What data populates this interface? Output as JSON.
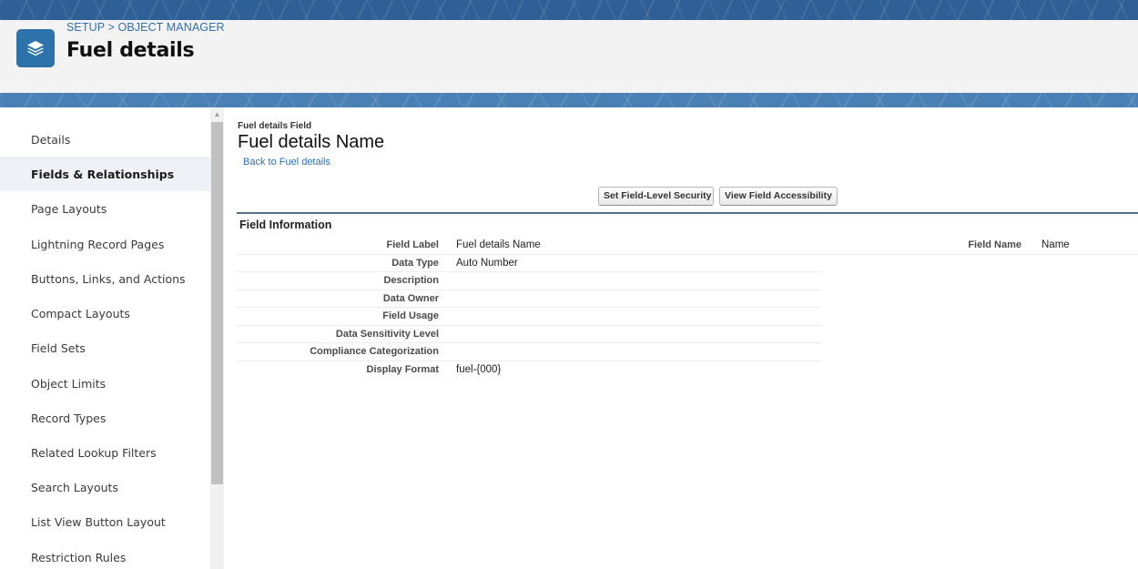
{
  "header": {
    "breadcrumb": "SETUP > OBJECT MANAGER",
    "object_title": "Fuel details",
    "icon": "layers-icon"
  },
  "sidebar": {
    "items": [
      {
        "label": "Details",
        "active": false
      },
      {
        "label": "Fields & Relationships",
        "active": true
      },
      {
        "label": "Page Layouts",
        "active": false
      },
      {
        "label": "Lightning Record Pages",
        "active": false
      },
      {
        "label": "Buttons, Links, and Actions",
        "active": false
      },
      {
        "label": "Compact Layouts",
        "active": false
      },
      {
        "label": "Field Sets",
        "active": false
      },
      {
        "label": "Object Limits",
        "active": false
      },
      {
        "label": "Record Types",
        "active": false
      },
      {
        "label": "Related Lookup Filters",
        "active": false
      },
      {
        "label": "Search Layouts",
        "active": false
      },
      {
        "label": "List View Button Layout",
        "active": false
      },
      {
        "label": "Restriction Rules",
        "active": false
      }
    ]
  },
  "main": {
    "eyebrow": "Fuel details Field",
    "title": "Fuel details Name",
    "back_link": "Back to Fuel details",
    "buttons": {
      "field_level_security": "Set Field-Level Security",
      "view_field_accessibility": "View Field Accessibility"
    },
    "section_title": "Field Information",
    "fields": [
      {
        "label": "Field Label",
        "value": "Fuel details Name"
      },
      {
        "label": "Data Type",
        "value": "Auto Number"
      },
      {
        "label": "Description",
        "value": ""
      },
      {
        "label": "Data Owner",
        "value": ""
      },
      {
        "label": "Field Usage",
        "value": ""
      },
      {
        "label": "Data Sensitivity Level",
        "value": ""
      },
      {
        "label": "Compliance Categorization",
        "value": ""
      },
      {
        "label": "Display Format",
        "value": "fuel-{000}"
      }
    ],
    "right_field": {
      "label": "Field Name",
      "value": "Name"
    }
  },
  "colors": {
    "brand_band": "#2f5f95",
    "icon_bg": "#2e72ab",
    "link": "#2f6fb0",
    "section_rule": "#56708c"
  }
}
